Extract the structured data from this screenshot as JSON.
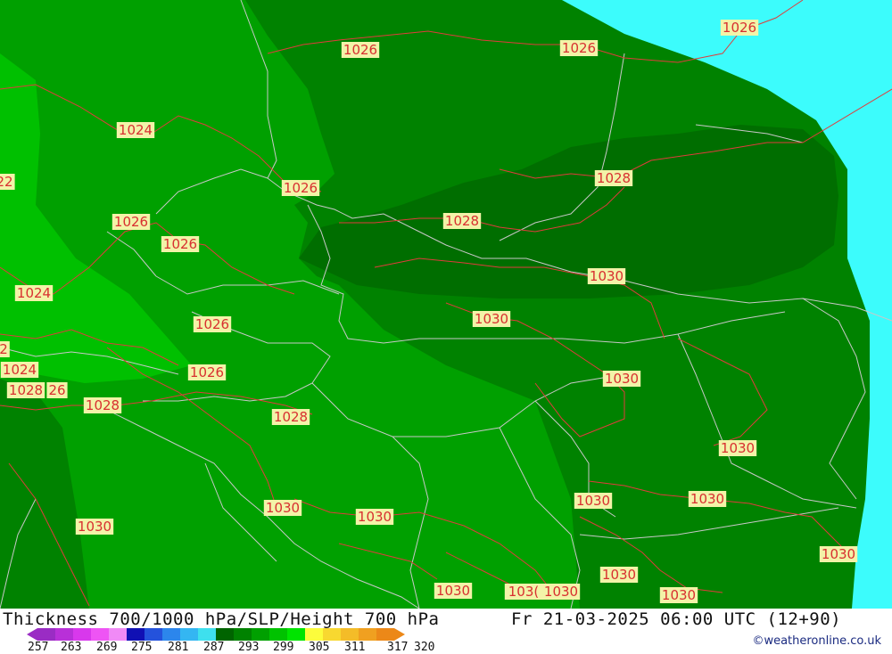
{
  "map": {
    "isobar_labels": [
      {
        "text": "1026"
      },
      {
        "text": "1026"
      },
      {
        "text": "1026"
      },
      {
        "text": "1024"
      },
      {
        "text": "22"
      },
      {
        "text": "1026"
      },
      {
        "text": "1028"
      },
      {
        "text": "1028"
      },
      {
        "text": "1026"
      },
      {
        "text": "1026"
      },
      {
        "text": "1024"
      },
      {
        "text": "1030"
      },
      {
        "text": "1030"
      },
      {
        "text": "1026"
      },
      {
        "text": "2"
      },
      {
        "text": "1024"
      },
      {
        "text": "1026"
      },
      {
        "text": "1028"
      },
      {
        "text": "26"
      },
      {
        "text": "1030"
      },
      {
        "text": "1028"
      },
      {
        "text": "1028"
      },
      {
        "text": "1030"
      },
      {
        "text": "1030"
      },
      {
        "text": "1030"
      },
      {
        "text": "1030"
      },
      {
        "text": "1030"
      },
      {
        "text": "1030"
      },
      {
        "text": "1030"
      },
      {
        "text": "1030"
      },
      {
        "text": "1030"
      },
      {
        "text": "1030"
      },
      {
        "text": "103("
      },
      {
        "text": "1030"
      }
    ]
  },
  "footer": {
    "title": "Thickness 700/1000 hPa/SLP/Height 700 hPa",
    "datetime": "Fr 21-03-2025 06:00 UTC (12+90)",
    "credit": "©weatheronline.co.uk"
  },
  "legend": {
    "colors": [
      "#9a2cc4",
      "#b830d8",
      "#d838ec",
      "#ee54f4",
      "#f08af6",
      "#1010b4",
      "#2452dc",
      "#2c86ec",
      "#34b6f2",
      "#3ee0ee",
      "#006400",
      "#008200",
      "#00a000",
      "#00c200",
      "#00e400",
      "#fcfc3c",
      "#f8d830",
      "#f4bc28",
      "#f0a020",
      "#ec8818"
    ],
    "tick_labels": [
      "257",
      "263",
      "269",
      "275",
      "281",
      "287",
      "293",
      "299",
      "305",
      "311",
      "317",
      "320"
    ]
  },
  "colors": {
    "green_light": "#00c000",
    "green_mid": "#00a000",
    "green_dark": "#008200",
    "green_darker": "#006e00",
    "cyan": "#3cfcfc",
    "isobar": "#e03c3c",
    "border": "#c8c8c8"
  }
}
